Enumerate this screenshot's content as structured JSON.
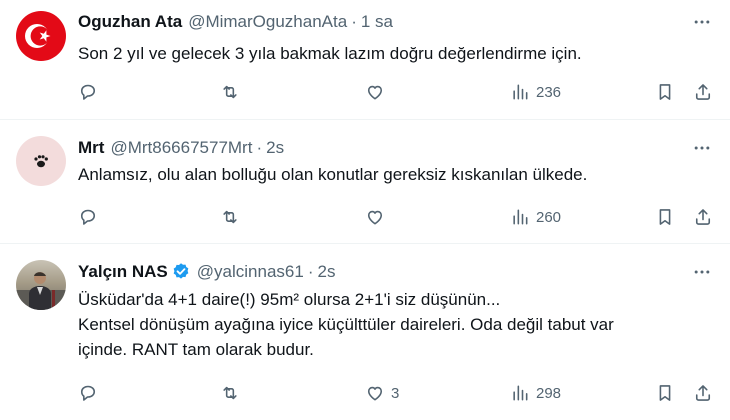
{
  "tweets": [
    {
      "name": "Oguzhan Ata",
      "handle": "@MimarOguzhanAta",
      "separator": "·",
      "time": "1 sa",
      "lines": [
        "Son 2 yıl ve gelecek 3 yıla bakmak lazım doğru değerlendirme için."
      ],
      "likes": "",
      "views": "236"
    },
    {
      "name": "Mrt",
      "handle": "@Mrt86667577Mrt",
      "separator": "·",
      "time": "2s",
      "lines": [
        "Anlamsız, olu alan bolluğu olan konutlar gereksiz kıskanılan ülkede."
      ],
      "likes": "",
      "views": "260"
    },
    {
      "name": "Yalçın NAS",
      "handle": "@yalcinnas61",
      "separator": "·",
      "time": "2s",
      "lines": [
        "Üsküdar'da 4+1 daire(!) 95m² olursa 2+1'i siz düşünün...",
        "Kentsel dönüşüm ayağına iyice küçülttüler daireleri. Oda değil tabut var",
        "içinde. RANT tam olarak budur."
      ],
      "likes": "3",
      "views": "298"
    }
  ],
  "colors": {
    "text": "#0f1419",
    "muted": "#536471",
    "divider": "#eff3f4",
    "verified": "#1d9bf0",
    "flag_red": "#e30a17"
  },
  "icons": [
    "more-icon",
    "reply-icon",
    "retweet-icon",
    "like-icon",
    "views-icon",
    "bookmark-icon",
    "share-icon",
    "verified-badge-icon",
    "paw-icon"
  ]
}
